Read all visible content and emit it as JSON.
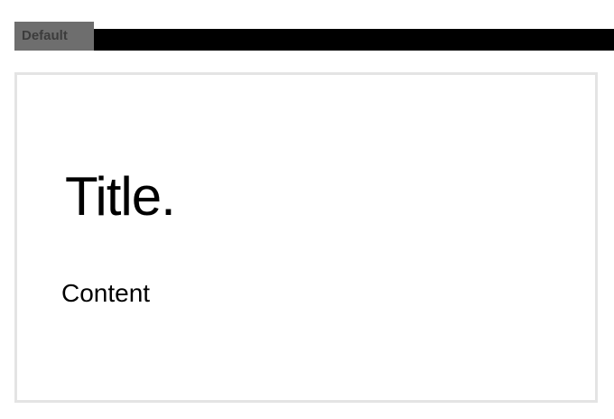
{
  "header": {
    "tab_label": "Default"
  },
  "card": {
    "title": "Title.",
    "content": "Content"
  }
}
